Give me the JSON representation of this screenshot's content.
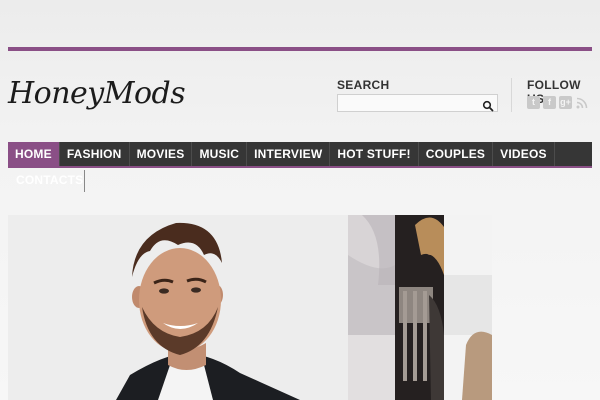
{
  "site": {
    "logo_text": "HoneyMods"
  },
  "search": {
    "title": "SEARCH",
    "value": "",
    "placeholder": ""
  },
  "follow": {
    "title": "FOLLOW US",
    "icons": [
      "twitter-icon",
      "facebook-icon",
      "google-plus-icon",
      "rss-icon"
    ]
  },
  "nav": {
    "items": [
      {
        "label": "HOME"
      },
      {
        "label": "FASHION"
      },
      {
        "label": "MOVIES"
      },
      {
        "label": "MUSIC"
      },
      {
        "label": "INTERVIEW"
      },
      {
        "label": "HOT STUFF!"
      },
      {
        "label": "COUPLES"
      },
      {
        "label": "VIDEOS"
      }
    ],
    "overflow_item": {
      "label": "CONTACTS"
    },
    "active": "HOME"
  },
  "colors": {
    "accent": "#8a4f86",
    "nav_bg": "#363636"
  }
}
